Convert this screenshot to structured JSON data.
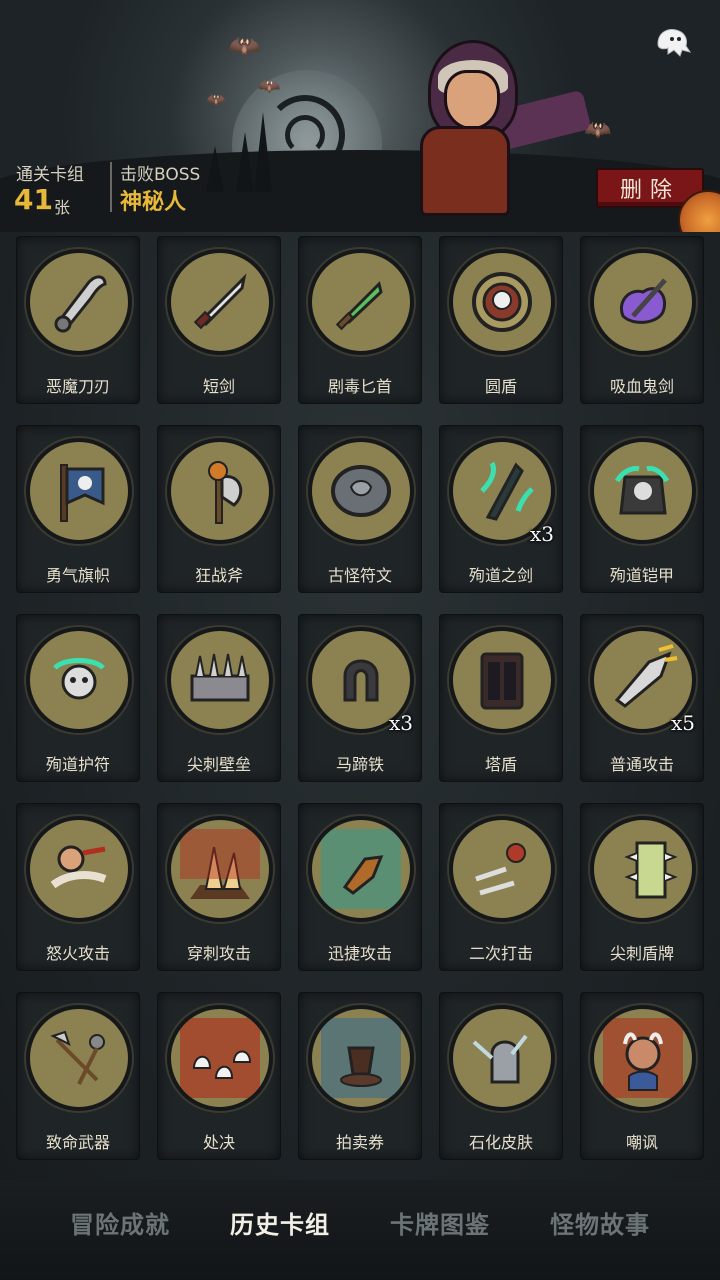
{
  "header": {
    "deck_label": "通关卡组",
    "deck_count": "41",
    "deck_unit": "张",
    "boss_label": "击败BOSS",
    "boss_name": "神秘人",
    "delete_label": "删除"
  },
  "colors": {
    "accent": "#e8b83a",
    "delete": "#7a1518",
    "card_art_bg": "#8c8150"
  },
  "cards": [
    {
      "name": "恶魔刀刃",
      "icon": "demon-blade-icon",
      "count": ""
    },
    {
      "name": "短剑",
      "icon": "short-sword-icon",
      "count": ""
    },
    {
      "name": "剧毒匕首",
      "icon": "poison-dagger-icon",
      "count": ""
    },
    {
      "name": "圆盾",
      "icon": "round-shield-icon",
      "count": ""
    },
    {
      "name": "吸血鬼剑",
      "icon": "vampire-sword-icon",
      "count": ""
    },
    {
      "name": "勇气旗帜",
      "icon": "courage-banner-icon",
      "count": ""
    },
    {
      "name": "狂战斧",
      "icon": "berserker-axe-icon",
      "count": ""
    },
    {
      "name": "古怪符文",
      "icon": "strange-rune-icon",
      "count": ""
    },
    {
      "name": "殉道之剑",
      "icon": "martyr-sword-icon",
      "count": "x3"
    },
    {
      "name": "殉道铠甲",
      "icon": "martyr-armor-icon",
      "count": ""
    },
    {
      "name": "殉道护符",
      "icon": "martyr-amulet-icon",
      "count": ""
    },
    {
      "name": "尖刺壁垒",
      "icon": "spike-barrier-icon",
      "count": ""
    },
    {
      "name": "马蹄铁",
      "icon": "horseshoe-icon",
      "count": "x3"
    },
    {
      "name": "塔盾",
      "icon": "tower-shield-icon",
      "count": ""
    },
    {
      "name": "普通攻击",
      "icon": "normal-attack-icon",
      "count": "x5"
    },
    {
      "name": "怒火攻击",
      "icon": "rage-attack-icon",
      "count": ""
    },
    {
      "name": "穿刺攻击",
      "icon": "pierce-attack-icon",
      "count": ""
    },
    {
      "name": "迅捷攻击",
      "icon": "swift-attack-icon",
      "count": ""
    },
    {
      "name": "二次打击",
      "icon": "double-strike-icon",
      "count": ""
    },
    {
      "name": "尖刺盾牌",
      "icon": "spike-shield-icon",
      "count": ""
    },
    {
      "name": "致命武器",
      "icon": "deadly-weapons-icon",
      "count": ""
    },
    {
      "name": "处决",
      "icon": "execute-icon",
      "count": ""
    },
    {
      "name": "拍卖券",
      "icon": "auction-ticket-icon",
      "count": ""
    },
    {
      "name": "石化皮肤",
      "icon": "petrify-skin-icon",
      "count": ""
    },
    {
      "name": "嘲讽",
      "icon": "taunt-icon",
      "count": ""
    }
  ],
  "nav": [
    {
      "label": "冒险成就",
      "active": false
    },
    {
      "label": "历史卡组",
      "active": true
    },
    {
      "label": "卡牌图鉴",
      "active": false
    },
    {
      "label": "怪物故事",
      "active": false
    }
  ]
}
